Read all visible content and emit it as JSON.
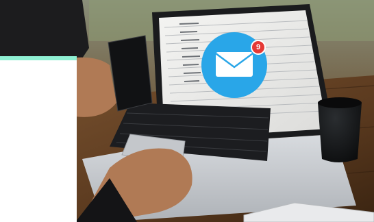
{
  "image": {
    "subject": "person-typing-on-laptop",
    "scene": "desk-with-laptop-phone-cup-tablet",
    "email_icon": "envelope-icon",
    "notification_count": "9"
  },
  "colors": {
    "accent_frame": "#8ff0d3",
    "email_circle": "#29a6e8",
    "badge": "#e53935",
    "table_wood": "#5b3a1f",
    "laptop_body": "#cfd2d6",
    "keyboard": "#1c1d20"
  }
}
